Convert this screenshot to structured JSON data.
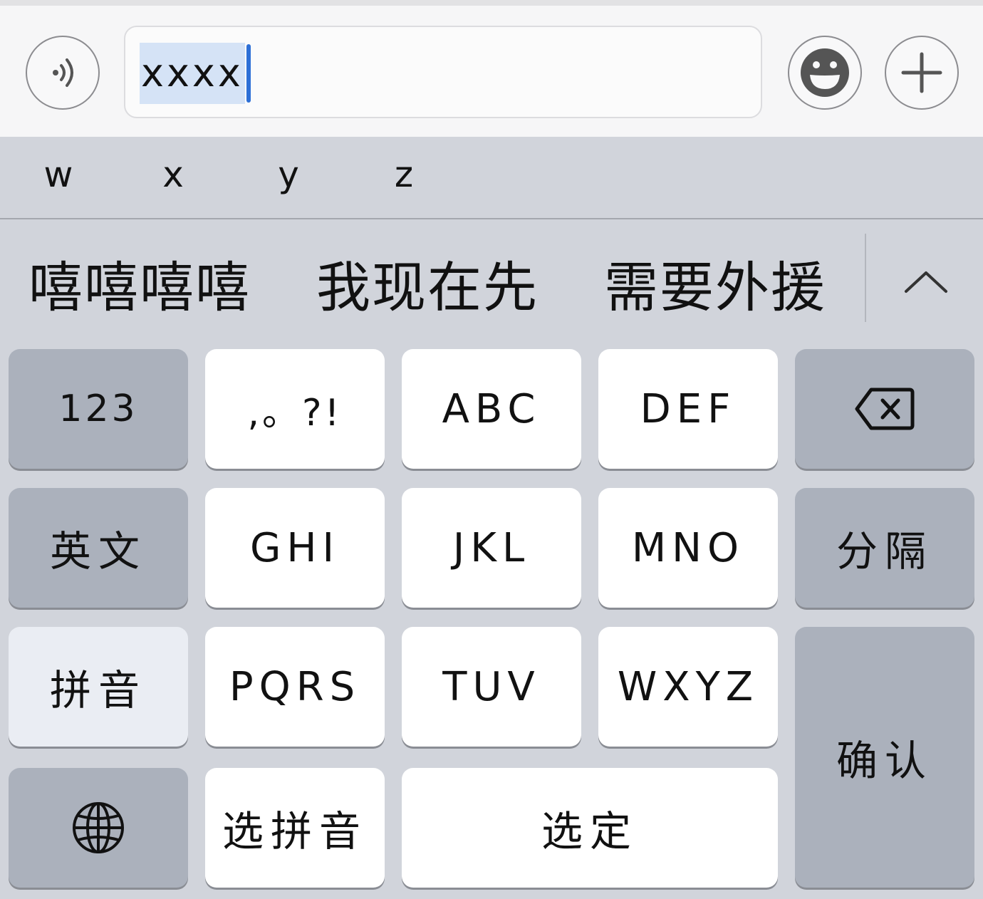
{
  "input": {
    "value": "xxxx"
  },
  "icons": {
    "voice": "voice-icon",
    "emoji": "emoji-icon",
    "plus": "plus-icon",
    "collapse": "chevron-up-icon",
    "backspace": "backspace-icon",
    "globe": "globe-icon"
  },
  "pinyin_letters": [
    "w",
    "x",
    "y",
    "z"
  ],
  "candidates": [
    "嘻嘻嘻嘻",
    "我现在先",
    "需要外援"
  ],
  "keys": {
    "num": "123",
    "punct": ",。?!",
    "abc": "ABC",
    "def": "DEF",
    "english": "英文",
    "ghi": "GHI",
    "jkl": "JKL",
    "mno": "MNO",
    "separate": "分隔",
    "pinyin": "拼音",
    "pqrs": "PQRS",
    "tuv": "TUV",
    "wxyz": "WXYZ",
    "confirm": "确认",
    "choose_pinyin": "选拼音",
    "select": "选定"
  },
  "colors": {
    "keyboard_bg": "#d1d4db",
    "key_white": "#ffffff",
    "key_gray": "#abb1bc",
    "caret": "#2d6fd6",
    "selection": "#d5e3f6"
  }
}
